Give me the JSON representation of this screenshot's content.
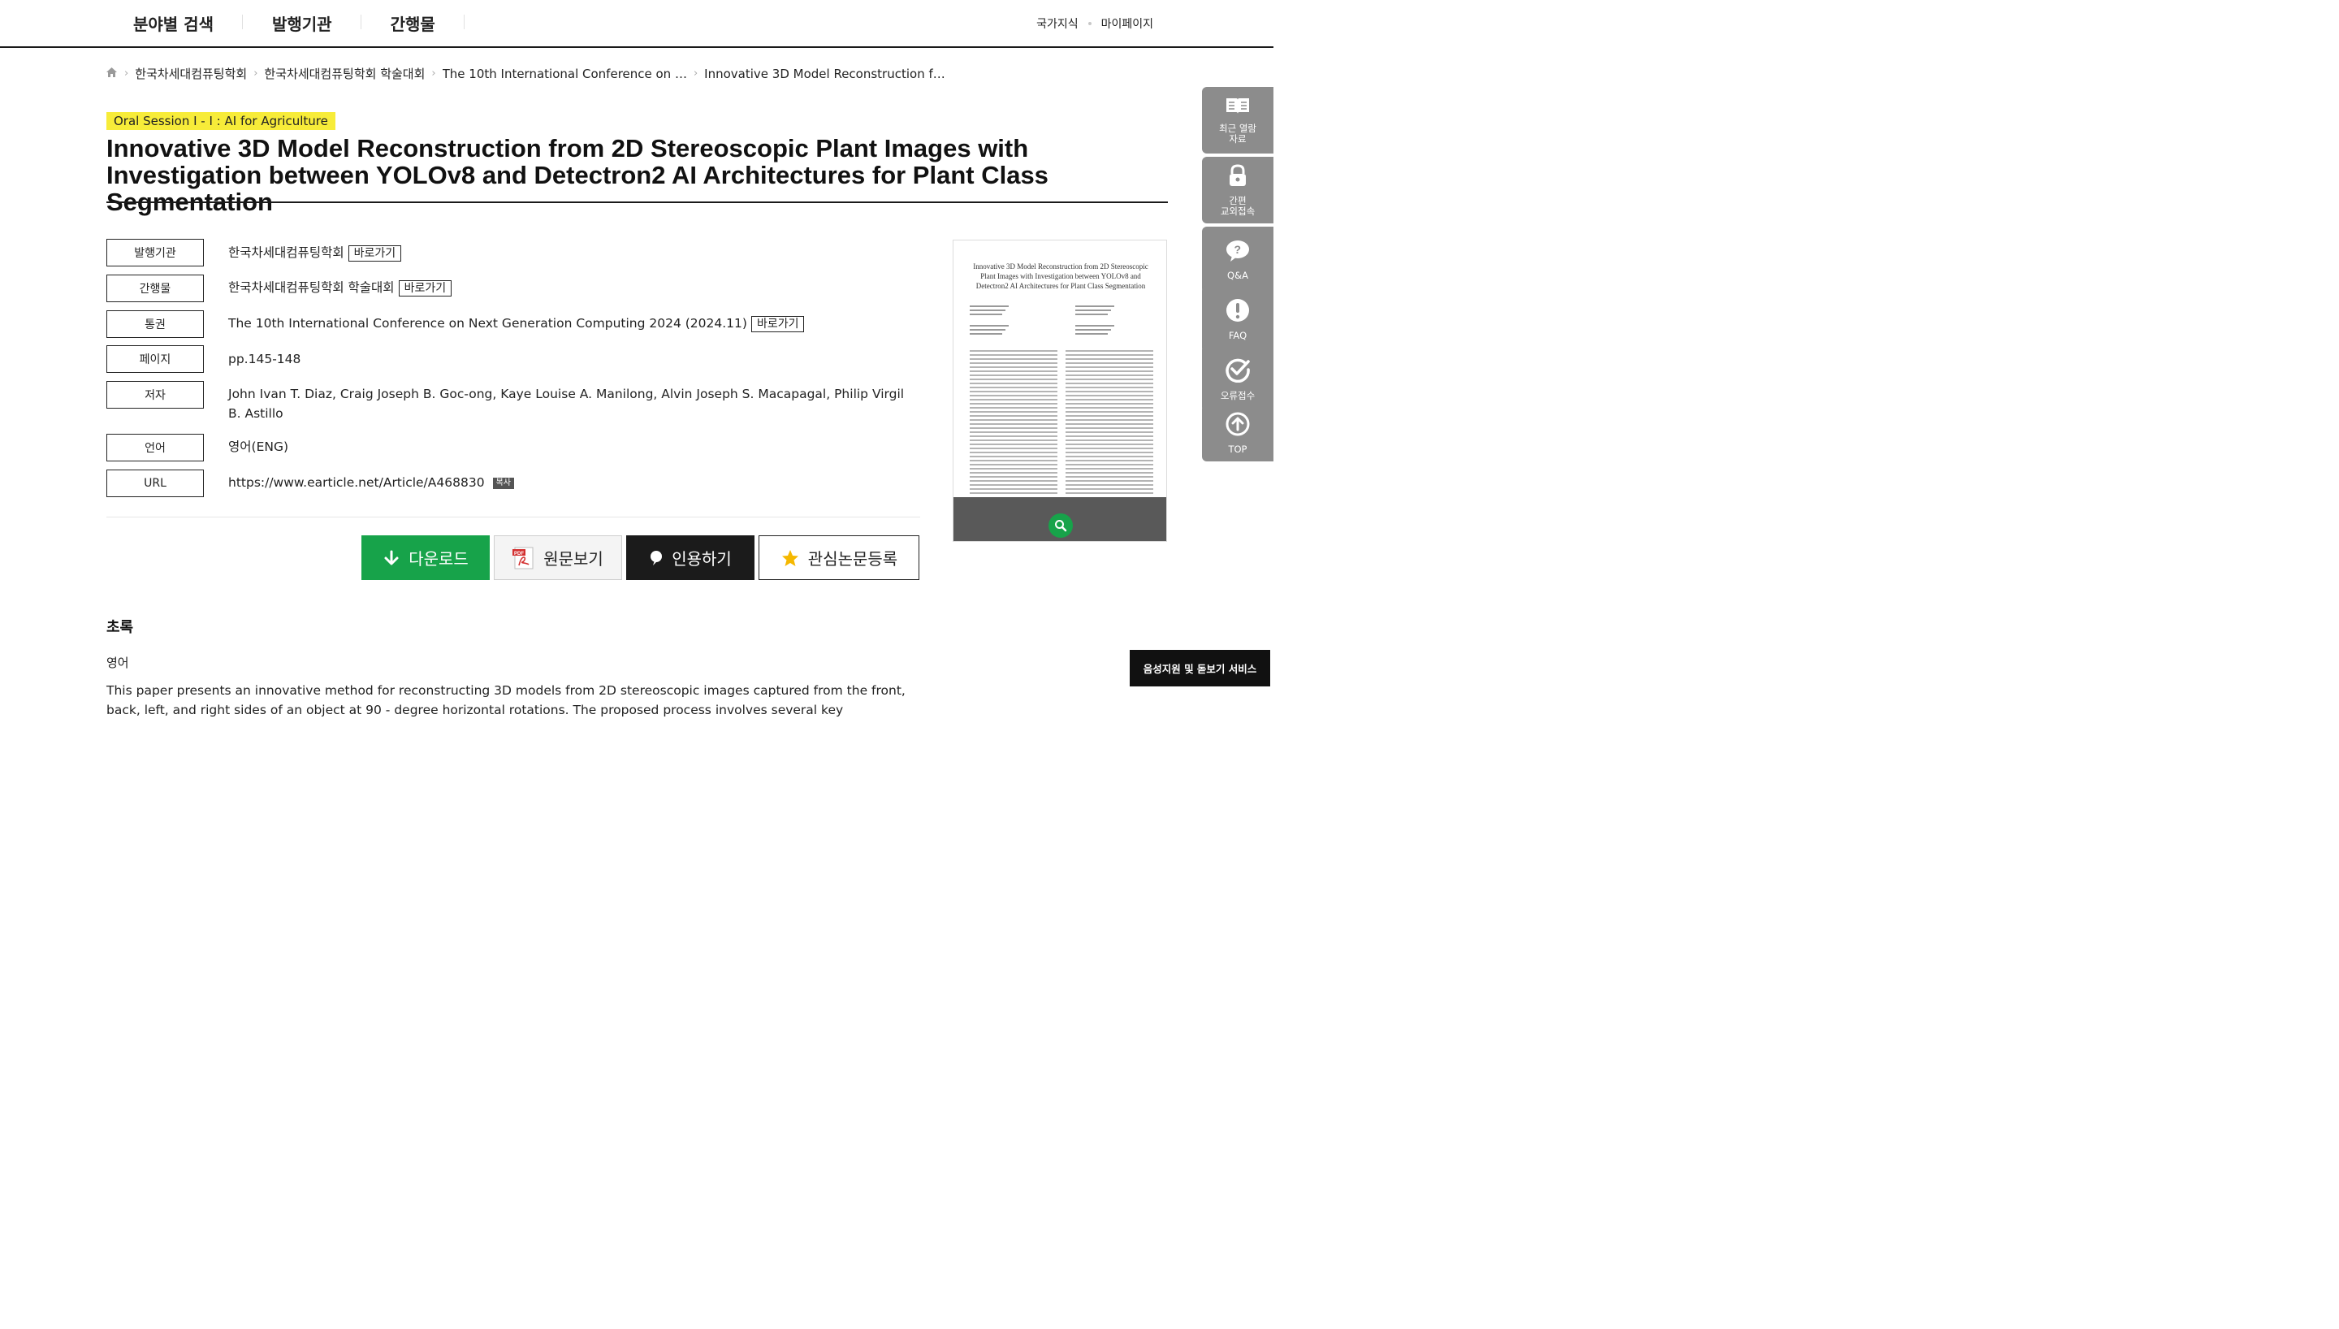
{
  "nav": {
    "menu": [
      "분야별 검색",
      "발행기관",
      "간행물"
    ],
    "right_links": [
      "국가지식",
      "마이페이지"
    ]
  },
  "breadcrumb": [
    "한국차세대컴퓨팅학회",
    "한국차세대컴퓨팅학회 학술대회",
    "The 10th International Conference on …",
    "Innovative 3D Model Reconstruction f…"
  ],
  "session_badge": "Oral Session I - I : AI for Agriculture",
  "title": "Innovative 3D Model Reconstruction from 2D Stereoscopic Plant Images with Investigation between YOLOv8 and Detectron2 AI Architectures for Plant Class Segmentation",
  "info": {
    "publisher_label": "발행기관",
    "publisher": "한국차세대컴퓨팅학회",
    "publication_label": "간행물",
    "publication": "한국차세대컴퓨팅학회 학술대회",
    "volume_label": "통권",
    "volume": "The 10th International Conference on Next Generation Computing 2024 (2024.11)",
    "pages_label": "페이지",
    "pages": "pp.145-148",
    "authors_label": "저자",
    "authors": "John Ivan T. Diaz, Craig Joseph B. Goc-ong, Kaye Louise A. Manilong, Alvin Joseph S. Macapagal, Philip Virgil B. Astillo",
    "language_label": "언어",
    "language": "영어(ENG)",
    "url_label": "URL",
    "url": "https://www.earticle.net/Article/A468830",
    "goto_label": "바로가기",
    "copy_label": "복사"
  },
  "actions": {
    "download": "다운로드",
    "view": "원문보기",
    "cite": "인용하기",
    "favorite": "관심논문등록"
  },
  "abstract": {
    "heading": "초록",
    "language": "영어",
    "text": "This paper presents an innovative method for reconstructing 3D models from 2D stereoscopic images captured from the front, back, left, and right sides of an object at 90 - degree horizontal rotations. The proposed process involves several key"
  },
  "preview": {
    "title": "Innovative 3D Model Reconstruction from 2D Stereoscopic Plant Images with Investigation between YOLOv8 and Detectron2 AI Architectures for Plant Class Segmentation"
  },
  "quick_menu": [
    {
      "label": "최근 열람\n자료",
      "icon": "book-icon"
    },
    {
      "label": "간편\n교외접속",
      "icon": "lock-icon"
    },
    {
      "label": "Q&A",
      "icon": "chat-question-icon"
    },
    {
      "label": "FAQ",
      "icon": "exclamation-icon"
    },
    {
      "label": "오류접수",
      "icon": "check-circle-icon"
    },
    {
      "label": "TOP",
      "icon": "arrow-up-icon"
    }
  ],
  "accessibility_button": "음성지원 및 돋보기 서비스",
  "colors": {
    "accent_green": "#17a34a",
    "badge_yellow": "#f7ec39",
    "quick_menu_gray": "#8c8c8c"
  }
}
